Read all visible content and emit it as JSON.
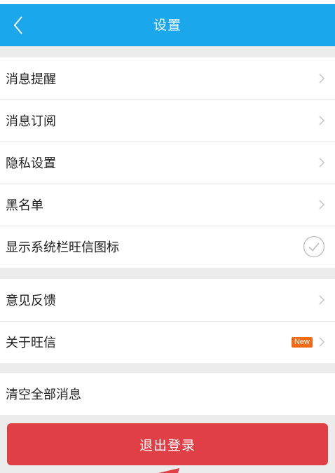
{
  "header": {
    "title": "设置",
    "back_icon": "chevron-left-icon",
    "background_color": "#1aa7ec"
  },
  "groups": [
    {
      "items": [
        {
          "label": "消息提醒",
          "trailing": "chevron"
        },
        {
          "label": "消息订阅",
          "trailing": "chevron"
        },
        {
          "label": "隐私设置",
          "trailing": "chevron"
        },
        {
          "label": "黑名单",
          "trailing": "chevron"
        },
        {
          "label": "显示系统栏旺信图标",
          "trailing": "checkmark"
        }
      ]
    },
    {
      "items": [
        {
          "label": "意见反馈",
          "trailing": "chevron"
        },
        {
          "label": "关于旺信",
          "trailing": "chevron",
          "badge": "New"
        }
      ]
    },
    {
      "items": [
        {
          "label": "清空全部消息",
          "trailing": "none"
        }
      ]
    }
  ],
  "logout": {
    "label": "退出登录",
    "color": "#e04045"
  },
  "colors": {
    "badge": "#f06a18",
    "background": "#ececec"
  }
}
